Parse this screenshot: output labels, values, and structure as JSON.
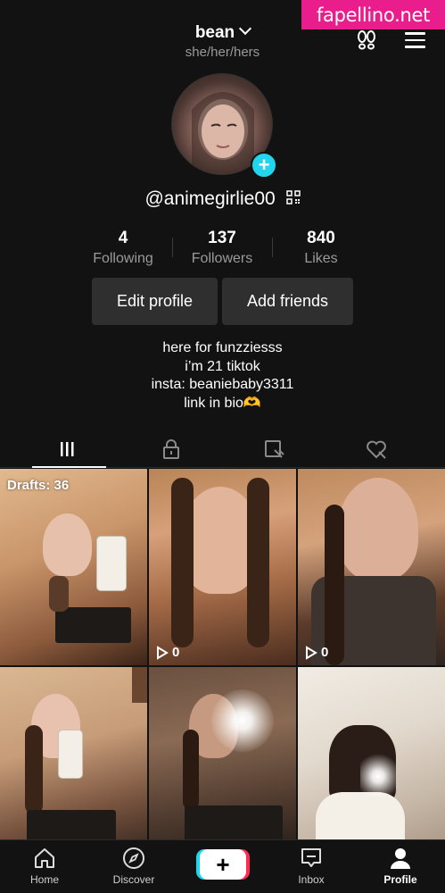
{
  "watermark": "fapellino.net",
  "header": {
    "username": "bean",
    "pronouns": "she/her/hers"
  },
  "profile": {
    "handle": "@animegirlie00"
  },
  "stats": [
    {
      "value": "4",
      "label": "Following"
    },
    {
      "value": "137",
      "label": "Followers"
    },
    {
      "value": "840",
      "label": "Likes"
    }
  ],
  "buttons": {
    "edit": "Edit profile",
    "add": "Add friends"
  },
  "bio": [
    "here for funzziesss",
    "i’m 21 tiktok",
    "insta: beaniebaby3311",
    "link in bio🫶"
  ],
  "tabs": [
    "videos-icon",
    "lock-icon",
    "saved-icon",
    "liked-icon"
  ],
  "grid": {
    "drafts_label": "Drafts: 36",
    "views": [
      "0",
      "0"
    ]
  },
  "nav": {
    "home": "Home",
    "discover": "Discover",
    "inbox": "Inbox",
    "profile": "Profile"
  },
  "colors": {
    "accent_cyan": "#20d5ec",
    "accent_red": "#fe2c55",
    "watermark_pink": "#e91e8c"
  }
}
